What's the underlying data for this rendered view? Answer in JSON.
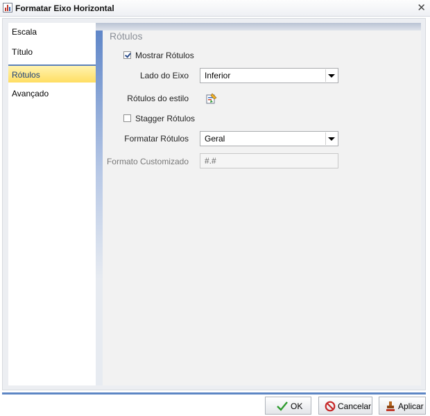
{
  "window": {
    "title": "Formatar Eixo Horizontal"
  },
  "nav": {
    "items": [
      {
        "label": "Escala"
      },
      {
        "label": "Título"
      },
      {
        "label": "Rótulos",
        "selected": true
      },
      {
        "label": "Avançado"
      }
    ]
  },
  "section": {
    "title": "Rótulos",
    "mostrar_rotulos": {
      "label": "Mostrar Rótulos",
      "checked": true
    },
    "lado_eixo": {
      "label": "Lado do Eixo",
      "value": "Inferior"
    },
    "rotulos_estilo": {
      "label": "Rótulos do estilo"
    },
    "stagger": {
      "label": "Stagger Rótulos",
      "checked": false
    },
    "formatar": {
      "label": "Formatar Rótulos",
      "value": "Geral"
    },
    "formato_custom": {
      "label": "Formato Customizado",
      "value": "#.#"
    }
  },
  "buttons": {
    "ok": "OK",
    "cancel": "Cancelar",
    "apply": "Aplicar"
  },
  "colors": {
    "accent": "#5d86c4",
    "selected_bg": "#ffde62",
    "disabled_text": "#777777"
  },
  "icons": {
    "window": "chart-icon",
    "close": "close-icon",
    "style": "paint-style-icon",
    "ok": "check-icon",
    "cancel": "no-entry-icon",
    "apply": "stamp-icon"
  }
}
